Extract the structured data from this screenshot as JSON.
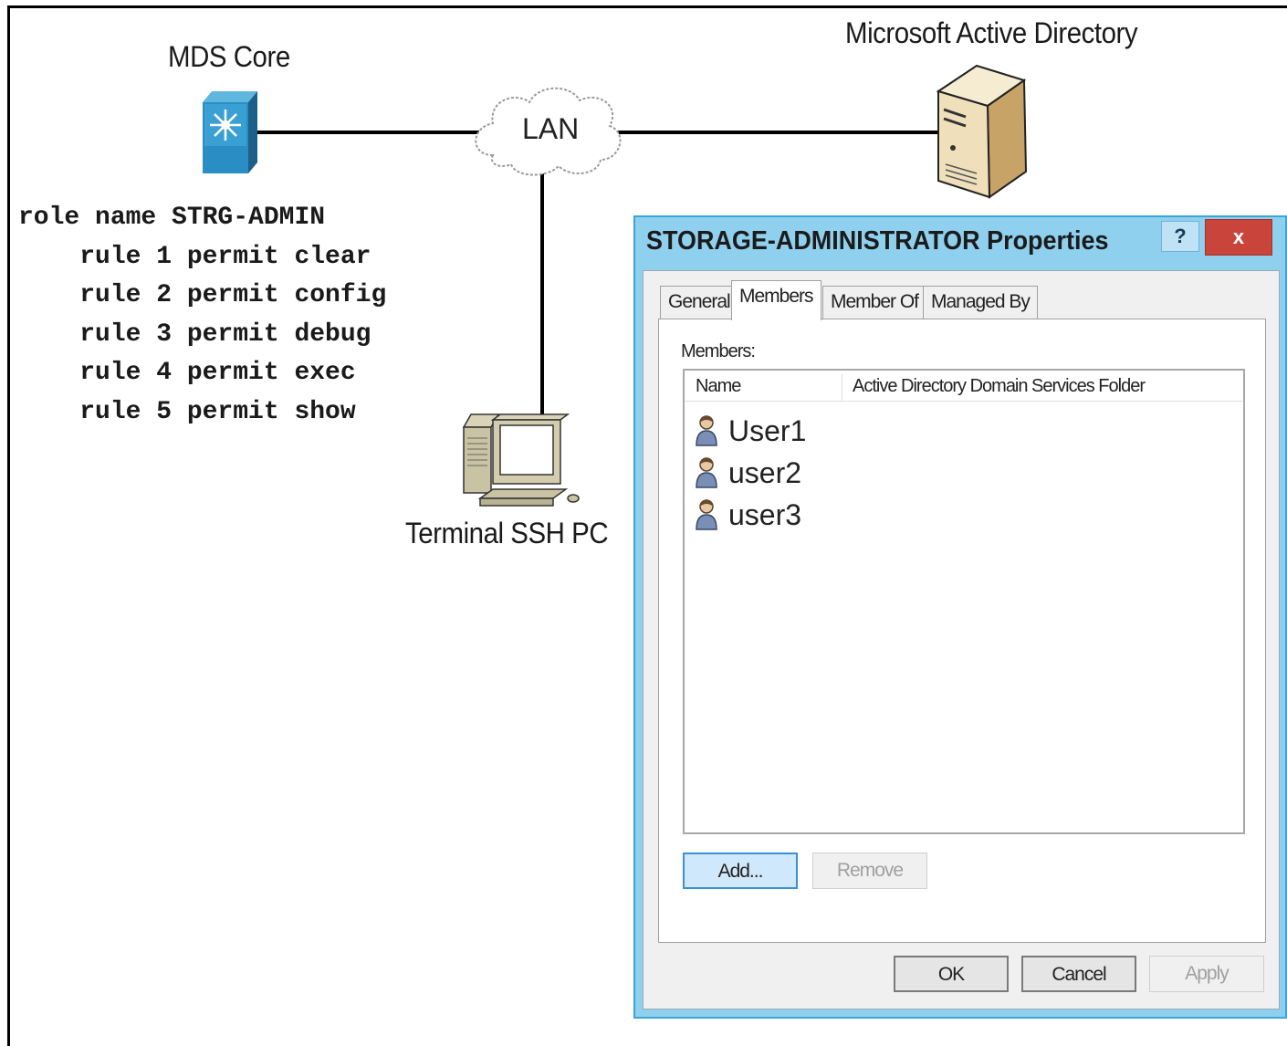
{
  "diagram": {
    "mds_label": "MDS Core",
    "lan_label": "LAN",
    "ad_label": "Microsoft Active Directory",
    "pc_label": "Terminal SSH PC",
    "cli": [
      "role name STRG-ADMIN",
      "    rule 1 permit clear",
      "    rule 2 permit config",
      "    rule 3 permit debug",
      "    rule 4 permit exec",
      "    rule 5 permit show"
    ]
  },
  "dialog": {
    "title": "STORAGE-ADMINISTRATOR Properties",
    "help": "?",
    "close": "x",
    "tabs": [
      "General",
      "Members",
      "Member Of",
      "Managed By"
    ],
    "active_tab": "Members",
    "members_label": "Members:",
    "columns": [
      "Name",
      "Active Directory Domain Services Folder"
    ],
    "members": [
      "User1",
      "user2",
      "user3"
    ],
    "buttons": {
      "add": "Add...",
      "remove": "Remove",
      "ok": "OK",
      "cancel": "Cancel",
      "apply": "Apply"
    }
  }
}
